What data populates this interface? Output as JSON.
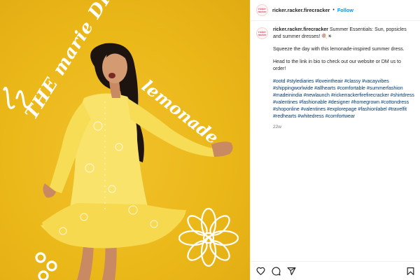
{
  "post": {
    "username": "ricker.racker.firecracker",
    "separator": "•",
    "follow_label": "Follow",
    "avatar_text": "ricker racker",
    "caption_intro": "Summer Essentials: Sun, popsicles and summer dresses! 🍭☀",
    "caption_line2": "Squeeze the day with this lemonade-inspired summer dress.",
    "caption_line3": "Head to the link in bio to check out our website or DM us to order!",
    "hashtags": "#ootd #stylediaries #loveintheair #classy #vacayvibes #shippingworlwide #allhearts #comfortable #summerfashion #madeinindia #newlaunch #rickerrackerfirefirecracker #shirtdress #valentines #fashionable #designer #homegrown #cottondress #shoponline #valentines #explorepage #fashionlabel #travelfit #redhearts #whitedress #comfortwear",
    "time_ago": "22w"
  },
  "photo": {
    "doodle_left": "THE marie DRESS",
    "doodle_right": "lemonade",
    "background": "#ebb819",
    "dress_color": "#f9e36a"
  },
  "actions": {
    "like_icon": "heart-icon",
    "comment_icon": "comment-icon",
    "share_icon": "paper-plane-icon",
    "save_icon": "bookmark-icon"
  }
}
